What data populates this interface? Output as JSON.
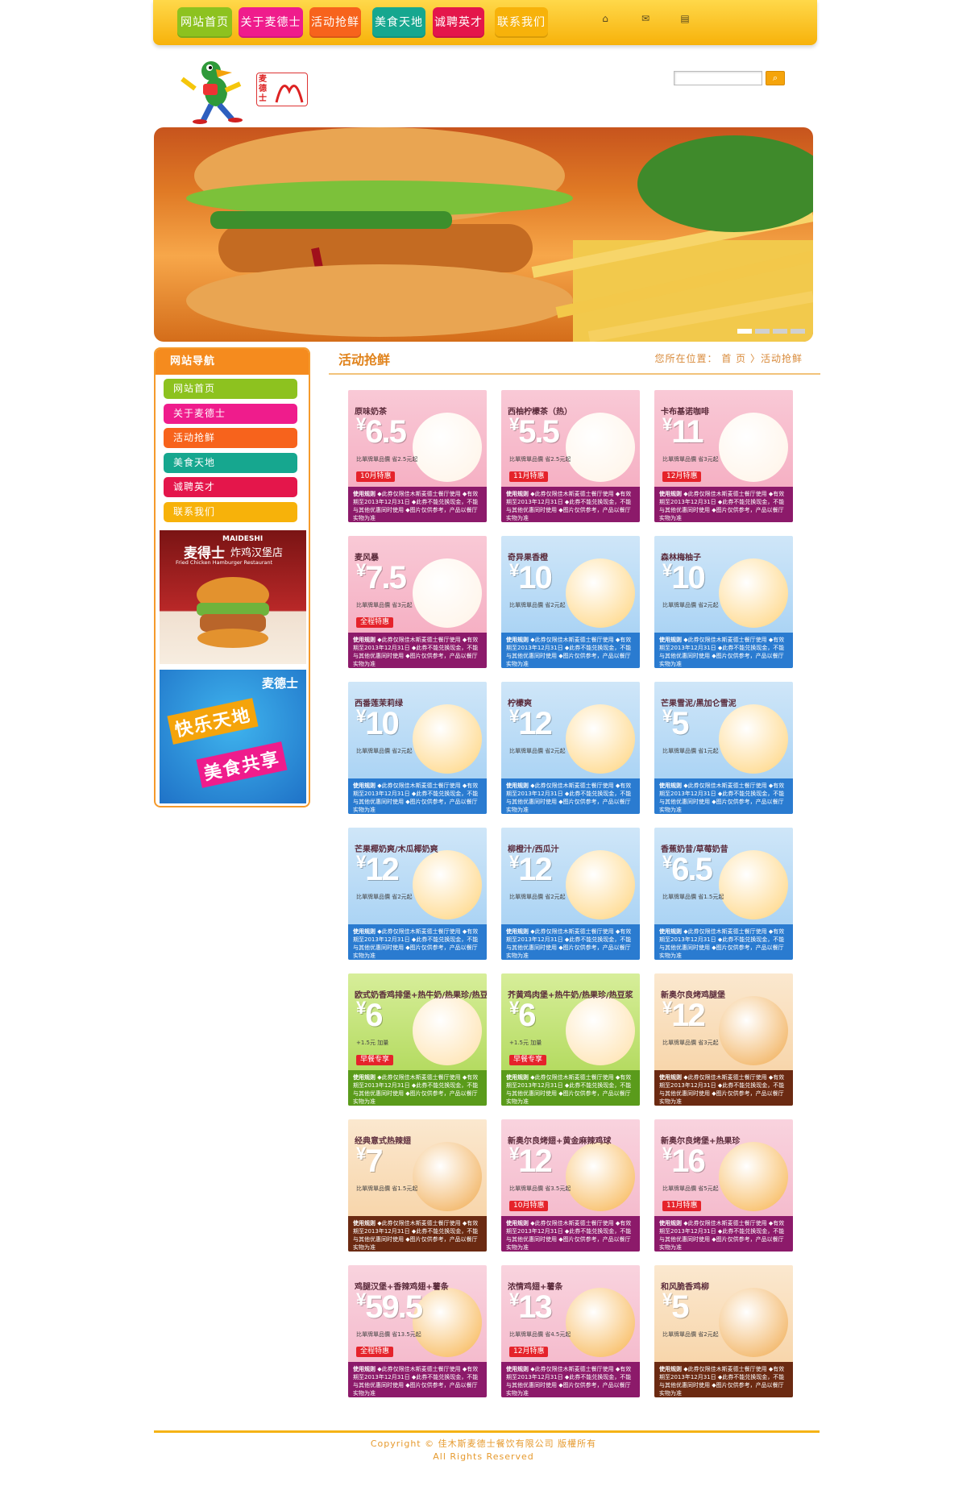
{
  "nav": {
    "items": [
      {
        "label": "网站首页",
        "color": "#8dc21f"
      },
      {
        "label": "关于麦德士",
        "color": "#ef1c8c"
      },
      {
        "label": "活动抢鲜",
        "color": "#f7631c"
      },
      {
        "label": "美食天地",
        "color": "#16a78f"
      },
      {
        "label": "诚聘英才",
        "color": "#e4164b"
      },
      {
        "label": "联系我们",
        "color": "#f7b20a"
      }
    ],
    "icons": [
      "home-icon",
      "mail-icon",
      "sitemap-icon"
    ]
  },
  "header": {
    "logo_text": "麦德士",
    "search_placeholder": "",
    "search_icon": "search-icon"
  },
  "sidebar": {
    "title": "网站导航",
    "items": [
      {
        "label": "网站首页",
        "color": "#8dc21f"
      },
      {
        "label": "关于麦德士",
        "color": "#ef1c8c"
      },
      {
        "label": "活动抢鲜",
        "color": "#f7631c"
      },
      {
        "label": "美食天地",
        "color": "#16a78f"
      },
      {
        "label": "诚聘英才",
        "color": "#e4164b"
      },
      {
        "label": "联系我们",
        "color": "#f7b20a"
      }
    ],
    "promo1": {
      "brand": "麦得士",
      "brand_en": "MAIDESHI",
      "subtitle": "炸鸡汉堡店",
      "subtitle_en": "Fried Chicken Hamburger Restaurant"
    },
    "promo2": {
      "brand": "麦德士",
      "line1": "快乐天地",
      "line2": "美食共享"
    }
  },
  "content": {
    "title": "活动抢鲜",
    "breadcrumb": "您所在位置： 首 页 〉活动抢鲜"
  },
  "coupons": [
    {
      "name": "原味奶茶",
      "price": "6.5",
      "save": "比單牌單品價 省2.5元起",
      "tag": "10月特惠",
      "theme": "pink"
    },
    {
      "name": "西柚柠檬茶（热）",
      "price": "5.5",
      "save": "比單牌單品價 省2.5元起",
      "tag": "11月特惠",
      "theme": "pink"
    },
    {
      "name": "卡布基诺咖啡",
      "price": "11",
      "save": "比單牌單品價 省3元起",
      "tag": "12月特惠",
      "theme": "pink"
    },
    {
      "name": "麦风暴",
      "price": "7.5",
      "save": "比單牌單品價 省3元起",
      "tag": "全程特惠",
      "theme": "pink"
    },
    {
      "name": "奇异果香橙",
      "price": "10",
      "save": "比單牌單品價 省2元起",
      "tag": "",
      "theme": "blue"
    },
    {
      "name": "森林梅柚子",
      "price": "10",
      "save": "比單牌單品價 省2元起",
      "tag": "",
      "theme": "blue"
    },
    {
      "name": "西番莲茉莉绿",
      "price": "10",
      "save": "比單牌單品價 省2元起",
      "tag": "",
      "theme": "blue"
    },
    {
      "name": "柠檬爽",
      "price": "12",
      "save": "比單牌單品價 省2元起",
      "tag": "",
      "theme": "blue"
    },
    {
      "name": "芒果雪泥/黑加仑雪泥",
      "price": "5",
      "save": "比單牌單品價 省1元起",
      "tag": "",
      "theme": "blue"
    },
    {
      "name": "芒果椰奶爽/木瓜椰奶爽",
      "price": "12",
      "save": "比單牌單品價 省2元起",
      "tag": "",
      "theme": "blue"
    },
    {
      "name": "柳橙汁/西瓜汁",
      "price": "12",
      "save": "比單牌單品價 省2元起",
      "tag": "",
      "theme": "blue"
    },
    {
      "name": "香蕉奶昔/草莓奶昔",
      "price": "6.5",
      "save": "比單牌單品價 省1.5元起",
      "tag": "",
      "theme": "blue"
    },
    {
      "name": "欧式奶香鸡排堡+热牛奶/热果珍/热豆浆",
      "price": "6",
      "save": "+1.5元 加量",
      "tag": "早餐专享",
      "theme": "green"
    },
    {
      "name": "芥黄鸡肉堡+热牛奶/热果珍/热豆浆",
      "price": "6",
      "save": "+1.5元 加量",
      "tag": "早餐专享",
      "theme": "green"
    },
    {
      "name": "新奥尔良烤鸡腿堡",
      "price": "12",
      "save": "比單牌單品價 省3元起",
      "tag": "",
      "theme": "brown"
    },
    {
      "name": "经典意式热辣翅",
      "price": "7",
      "save": "比單牌單品價 省1.5元起",
      "tag": "",
      "theme": "brown"
    },
    {
      "name": "新奥尔良烤翅+黄金麻辣鸡球",
      "price": "12",
      "save": "比單牌單品價 省3.5元起",
      "tag": "10月特惠",
      "theme": "purple"
    },
    {
      "name": "新奥尔良烤堡+热果珍",
      "price": "16",
      "save": "比單牌單品價 省5元起",
      "tag": "11月特惠",
      "theme": "purple"
    },
    {
      "name": "鸡腿汉堡+香辣鸡翅+薯条",
      "price": "59.5",
      "save": "比單牌單品價 省13.5元起",
      "tag": "全程特惠",
      "theme": "purple"
    },
    {
      "name": "浓情鸡翅+薯条",
      "price": "13",
      "save": "比單牌單品價 省4.5元起",
      "tag": "12月特惠",
      "theme": "purple"
    },
    {
      "name": "和风脆香鸡柳",
      "price": "5",
      "save": "比單牌單品價 省2元起",
      "tag": "",
      "theme": "brown"
    }
  ],
  "coupon_rules_label": "使用规则",
  "coupon_rules_text": "◆此券仅限佳木斯麦德士餐厅使用 ◆有效期至2013年12月31日 ◆此券不能兑换现金，不能与其他优惠同时使用 ◆图片仅供参考，产品以餐厅实物为准",
  "footer": {
    "copyright": "Copyright © 佳木斯麦德士餐饮有限公司 版權所有",
    "rights": "All Rights Reserved"
  }
}
